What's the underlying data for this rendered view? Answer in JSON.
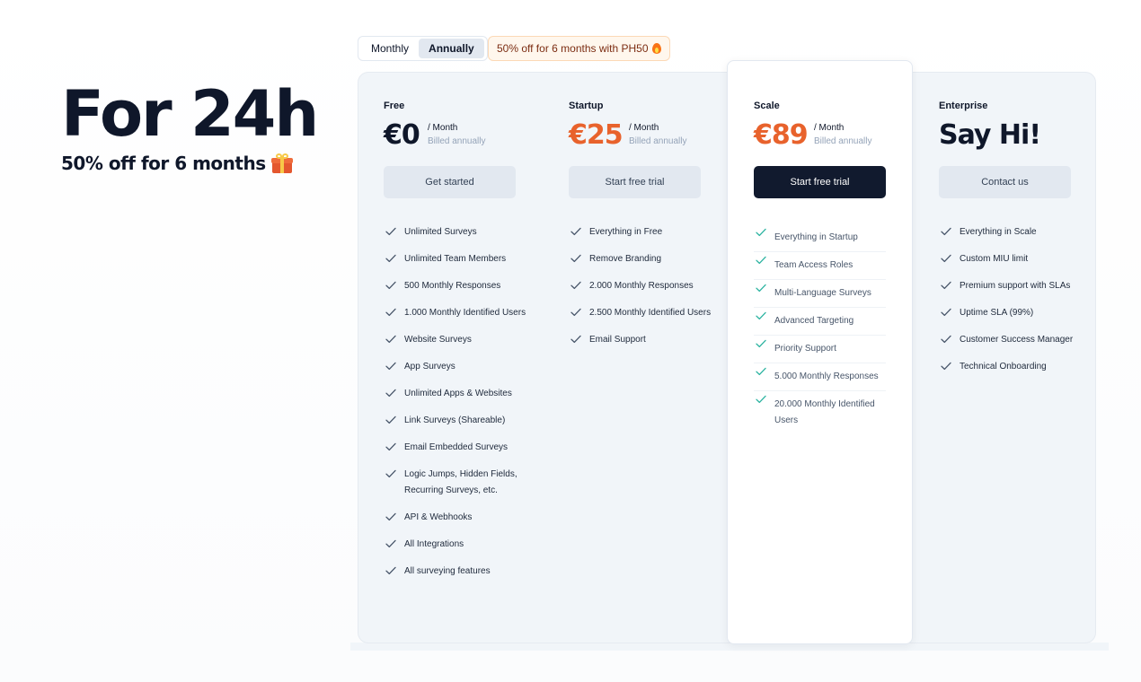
{
  "promo": {
    "title": "For 24h",
    "subtitle": "50% off for 6 months",
    "icon": "gift-icon"
  },
  "billing_toggle": {
    "options": [
      "Monthly",
      "Annually"
    ],
    "selected": "Annually"
  },
  "promo_badge": {
    "text": "50% off for 6 months with PH50",
    "icon": "fire-icon"
  },
  "colors": {
    "accent_orange": "#e8622c",
    "check_green": "#2bb3a0",
    "dark_button": "#111a2e"
  },
  "plans": [
    {
      "name": "Free",
      "price": "€0",
      "per": "/ Month",
      "billed": "Billed annually",
      "cta": "Get started",
      "features": [
        "Unlimited Surveys",
        "Unlimited Team Members",
        "500 Monthly Responses",
        "1.000 Monthly Identified Users",
        "Website Surveys",
        "App Surveys",
        "Unlimited Apps & Websites",
        "Link Surveys (Shareable)",
        "Email Embedded Surveys",
        "Logic Jumps, Hidden Fields, Recurring Surveys, etc.",
        "API & Webhooks",
        "All Integrations",
        "All surveying features"
      ]
    },
    {
      "name": "Startup",
      "price": "€25",
      "per": "/ Month",
      "billed": "Billed annually",
      "cta": "Start free trial",
      "features": [
        "Everything in Free",
        "Remove Branding",
        "2.000 Monthly Responses",
        "2.500 Monthly Identified Users",
        "Email Support"
      ]
    },
    {
      "name": "Scale",
      "price": "€89",
      "per": "/ Month",
      "billed": "Billed annually",
      "cta": "Start free trial",
      "features": [
        "Everything in Startup",
        "Team Access Roles",
        "Multi-Language Surveys",
        "Advanced Targeting",
        "Priority Support",
        "5.000 Monthly Responses",
        "20.000 Monthly Identified Users"
      ]
    },
    {
      "name": "Enterprise",
      "price": "Say Hi!",
      "cta": "Contact us",
      "features": [
        "Everything in Scale",
        "Custom MIU limit",
        "Premium support with SLAs",
        "Uptime SLA (99%)",
        "Customer Success Manager",
        "Technical Onboarding"
      ]
    }
  ]
}
